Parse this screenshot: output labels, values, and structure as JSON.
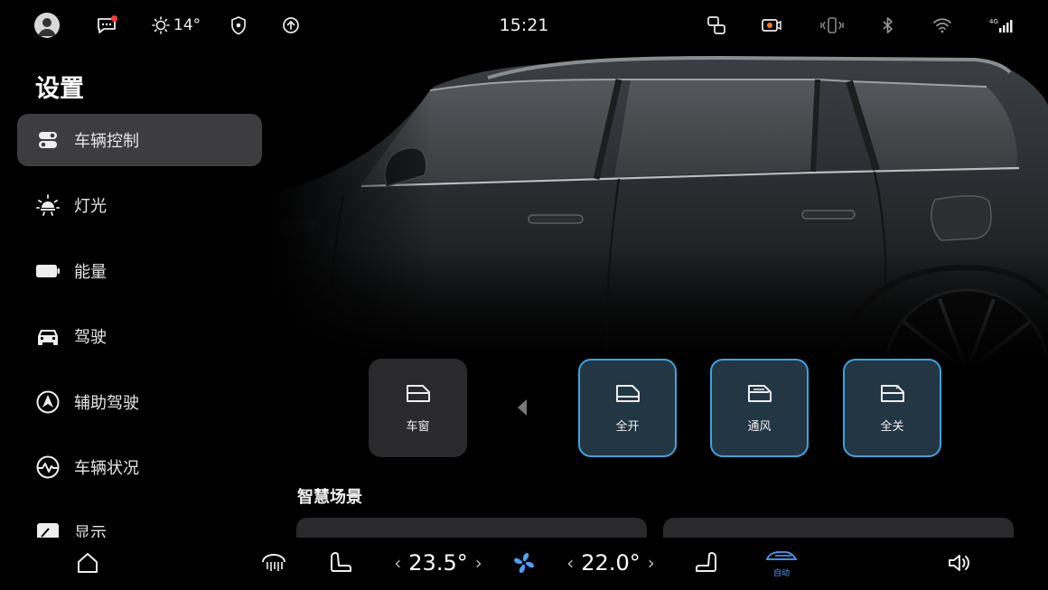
{
  "status_bar": {
    "time": "15:21",
    "weather_temp": "14°",
    "icons": [
      "avatar-icon",
      "message-icon",
      "sun-icon",
      "shield-icon",
      "upload-icon",
      "screen-cast-icon",
      "dashcam-icon",
      "vibrate-icon",
      "bluetooth-icon",
      "wifi-icon",
      "signal-4g-icon"
    ],
    "network": "4G",
    "notification_dot_color": "#ff3b30"
  },
  "sidebar": {
    "title": "设置",
    "items": [
      {
        "label": "车辆控制",
        "icon": "toggle-switches-icon",
        "active": true
      },
      {
        "label": "灯光",
        "icon": "light-icon",
        "active": false
      },
      {
        "label": "能量",
        "icon": "battery-icon",
        "active": false
      },
      {
        "label": "驾驶",
        "icon": "car-front-icon",
        "active": false
      },
      {
        "label": "辅助驾驶",
        "icon": "assist-drive-icon",
        "active": false
      },
      {
        "label": "车辆状况",
        "icon": "pulse-icon",
        "active": false
      },
      {
        "label": "显示",
        "icon": "display-icon",
        "active": false
      }
    ]
  },
  "windows": {
    "base_label": "车窗",
    "options": [
      {
        "label": "全开",
        "selected": true
      },
      {
        "label": "通风",
        "selected": true
      },
      {
        "label": "全关",
        "selected": true
      }
    ]
  },
  "scenes": {
    "title": "智慧场景"
  },
  "dock": {
    "driver_temp": "23.5°",
    "passenger_temp": "22.0°",
    "left_chevron": "‹",
    "right_chevron": "›",
    "auto_label": "自动",
    "accent": "#4aa3ff"
  }
}
